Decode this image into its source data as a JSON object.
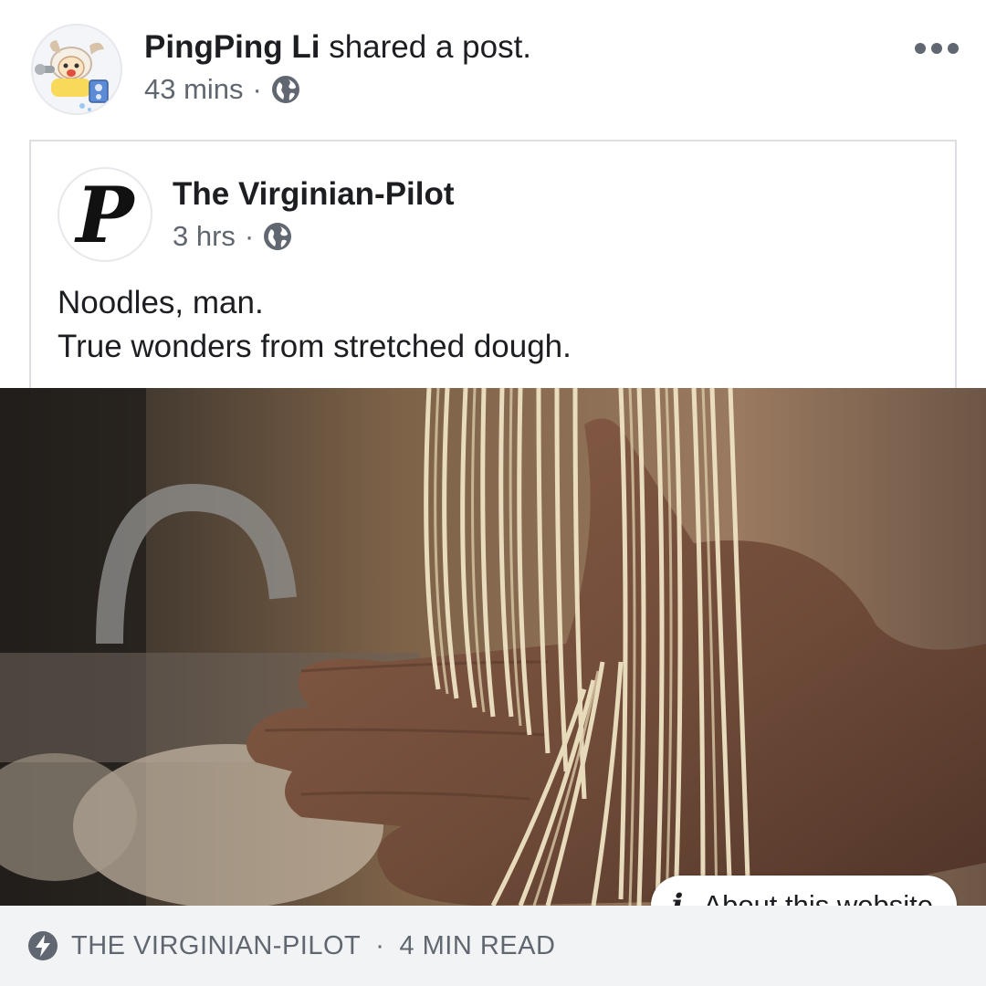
{
  "sharer": {
    "name": "PingPing Li",
    "action": "shared a post.",
    "time": "43 mins",
    "separator": "·",
    "privacy_icon": "globe-icon"
  },
  "more_icon": "more-options-icon",
  "embedded_post": {
    "page_name": "The Virginian-Pilot",
    "logo_letter": "P",
    "time": "3 hrs",
    "separator": "·",
    "privacy_icon": "globe-icon",
    "text_lines": [
      "Noodles, man.",
      "True wonders from stretched dough."
    ]
  },
  "photo": {
    "subject": "noodles-in-hand"
  },
  "about_pill": {
    "icon": "i",
    "label": "About this website"
  },
  "link_footer": {
    "icon": "instant-article-bolt-icon",
    "source": "THE VIRGINIAN-PILOT",
    "separator": "·",
    "read_time": "4 MIN READ"
  },
  "colors": {
    "primary_text": "#1c1e21",
    "secondary_text": "#606770",
    "border": "#dddfe2",
    "footer_bg": "#f2f3f5"
  }
}
